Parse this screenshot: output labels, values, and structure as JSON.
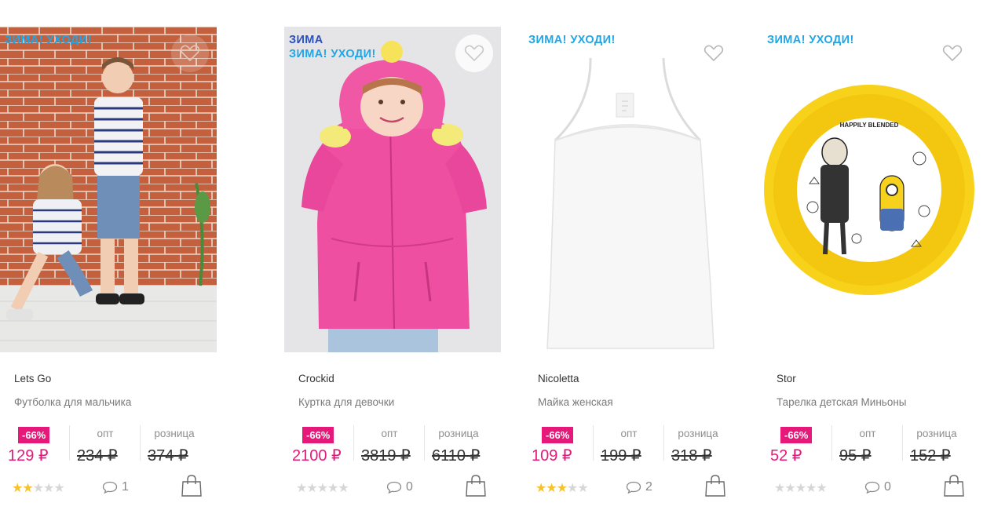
{
  "products": [
    {
      "promo_lines": [
        "ЗИМА",
        "ЗИМА! УХОДИ!"
      ],
      "brand": "Crockid",
      "title": "Куртка для девочки",
      "discount": "-66%",
      "price": "2100 ₽",
      "opt_label": "опт",
      "opt_price": "3819 ₽",
      "retail_label": "розница",
      "retail_price": "6110 ₽",
      "rating": 0,
      "stars_max": 5,
      "comments": "0",
      "image_desc": "girl-pink-jacket"
    },
    {
      "promo_lines": [
        "ЗИМА! УХОДИ!"
      ],
      "brand": "Nicoletta",
      "title": "Майка женская",
      "discount": "-66%",
      "price": "109 ₽",
      "opt_label": "опт",
      "opt_price": "199 ₽",
      "retail_label": "розница",
      "retail_price": "318 ₽",
      "rating": 3,
      "stars_max": 5,
      "comments": "2",
      "image_desc": "white-tank-top"
    },
    {
      "promo_lines": [
        "ЗИМА! УХОДИ!"
      ],
      "brand": "Stor",
      "title": "Тарелка детская Миньоны",
      "discount": "-66%",
      "price": "52 ₽",
      "opt_label": "опт",
      "opt_price": "95 ₽",
      "retail_label": "розница",
      "retail_price": "152 ₽",
      "rating": 0,
      "stars_max": 5,
      "comments": "0",
      "image_desc": "minions-yellow-plate",
      "image_text": "HAPPILY BLENDED"
    },
    {
      "promo_lines": [
        "ЗИМА! УХОДИ!"
      ],
      "brand": "Lets Go",
      "title": "Футболка для мальчика",
      "discount": "-66%",
      "price": "129 ₽",
      "opt_label": "опт",
      "opt_price": "234 ₽",
      "retail_label": "розница",
      "retail_price": "374 ₽",
      "rating": 2,
      "stars_max": 5,
      "comments": "1",
      "image_desc": "kids-brick-wall"
    }
  ],
  "icons": {
    "favorite": "heart-outline-icon",
    "comments": "speech-bubble-icon",
    "cart": "shopping-bag-icon",
    "rating": "star-icon"
  },
  "colors": {
    "accent": "#e6197a",
    "promo_primary": "#2a4fbf",
    "promo_secondary": "#1ea6e8",
    "star_on": "#f6c12b",
    "star_off": "#d6d6d6"
  }
}
